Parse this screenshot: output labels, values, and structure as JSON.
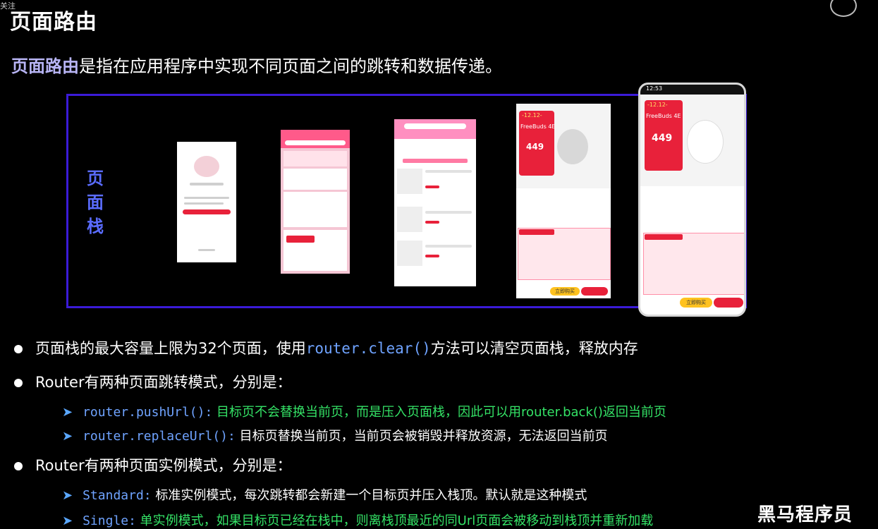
{
  "corner_tag": "关注",
  "title": "页面路由",
  "intro": {
    "highlight": "页面路由",
    "rest": "是指在应用程序中实现不同页面之间的跳转和数据传递。"
  },
  "stack_label": [
    "页",
    "面",
    "栈"
  ],
  "screens": {
    "s4": {
      "price": "449",
      "badge": "-12.12-",
      "product": "FreeBuds 4E",
      "cta": "立即购买"
    },
    "s5": {
      "time": "12:53",
      "price": "449",
      "badge": "-12.12-",
      "product": "FreeBuds 4E",
      "cta": "立即购买"
    }
  },
  "bullets": [
    {
      "pre": "页面栈的最大容量上限为32个页面，使用",
      "code": "router.clear()",
      "post": "方法可以清空页面栈，释放内存"
    },
    {
      "text": "Router有两种页面跳转模式，分别是："
    },
    {
      "text": "Router有两种页面实例模式，分别是："
    }
  ],
  "sub_items": [
    {
      "code": "router.pushUrl():",
      "text": " 目标页不会替换当前页，而是压入页面栈，因此可以用router.back()返回当前页"
    },
    {
      "code": "router.replaceUrl():",
      "text": " 目标页替换当前页，当前页会被销毁并释放资源，无法返回当前页"
    },
    {
      "code": "Standard:",
      "text": " 标准实例模式，每次跳转都会新建一个目标页并压入栈顶。默认就是这种模式"
    },
    {
      "code": "Single:",
      "text": " 单实例模式，如果目标页已经在栈中，则离栈顶最近的同Url页面会被移动到栈顶并重新加载"
    }
  ],
  "watermark": "黑马程序员",
  "colors": {
    "accent": "#3b1bd8",
    "code": "#6fa3ff",
    "green": "#34e266",
    "highlight": "#b8b5f5"
  }
}
